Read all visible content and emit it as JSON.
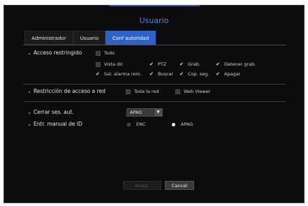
{
  "dialog": {
    "title": "Usuario"
  },
  "tabs": [
    {
      "label": "Administrador",
      "active": false
    },
    {
      "label": "Usuario",
      "active": false
    },
    {
      "label": "Conf autoridad",
      "active": true
    }
  ],
  "restricted_access": {
    "label": "Acceso restringido",
    "options": [
      {
        "label": "Todo",
        "checked": false
      },
      {
        "label": "Vista dir.",
        "checked": false
      },
      {
        "label": "PTZ",
        "checked": true
      },
      {
        "label": "Grab.",
        "checked": true
      },
      {
        "label": "Detener grab.",
        "checked": true
      },
      {
        "label": "Sal. alarma rem.",
        "checked": true
      },
      {
        "label": "Buscar",
        "checked": true
      },
      {
        "label": "Cop. seg.",
        "checked": true
      },
      {
        "label": "Apagar",
        "checked": true
      }
    ]
  },
  "network_restriction": {
    "label": "Restricción de acceso a red",
    "options": [
      {
        "label": "Toda la red",
        "checked": false
      },
      {
        "label": "Web Viewer",
        "checked": false
      }
    ]
  },
  "auto_logout": {
    "label": "Cerrar ses. aut.",
    "value": "APAG"
  },
  "manual_id": {
    "label": "Entr. manual de ID",
    "options": [
      {
        "label": "ENC",
        "selected": false
      },
      {
        "label": "APAG",
        "selected": true
      }
    ]
  },
  "buttons": {
    "accept": "Acept.",
    "cancel": "Cancel"
  },
  "colors": {
    "accent": "#2d62c8",
    "title": "#4f88e0",
    "background": "#0c0c0e"
  }
}
